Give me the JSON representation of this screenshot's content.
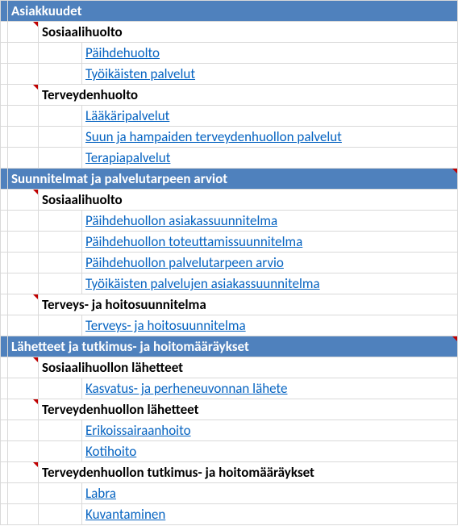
{
  "sections": [
    {
      "title": "Asiakkuudet",
      "groups": [
        {
          "label": "Sosiaalihuolto",
          "items": [
            "Päihdehuolto",
            "Työikäisten palvelut"
          ]
        },
        {
          "label": "Terveydenhuolto",
          "items": [
            "Lääkäripalvelut",
            "Suun ja hampaiden terveydenhuollon palvelut ",
            "Terapiapalvelut "
          ]
        }
      ]
    },
    {
      "title": "Suunnitelmat ja palvelutarpeen arviot",
      "groups": [
        {
          "label": "Sosiaalihuolto",
          "items": [
            "Päihdehuollon asiakassuunnitelma",
            "Päihdehuollon toteuttamissuunnitelma",
            "Päihdehuollon palvelutarpeen arvio",
            "Työikäisten palvelujen asiakassuunnitelma"
          ]
        },
        {
          "label": "Terveys- ja hoitosuunnitelma",
          "items": [
            "Terveys- ja hoitosuunnitelma"
          ]
        }
      ]
    },
    {
      "title": "Lähetteet ja tutkimus- ja hoitomääräykset",
      "groups": [
        {
          "label": "Sosiaalihuollon lähetteet",
          "items": [
            "Kasvatus- ja perheneuvonnan lähete"
          ]
        },
        {
          "label": "Terveydenhuollon lähetteet",
          "items": [
            "Erikoissairaanhoito",
            "Kotihoito"
          ]
        },
        {
          "label": "Terveydenhuollon tutkimus- ja hoitomääräykset",
          "items": [
            "Labra",
            "Kuvantaminen"
          ]
        }
      ]
    }
  ]
}
